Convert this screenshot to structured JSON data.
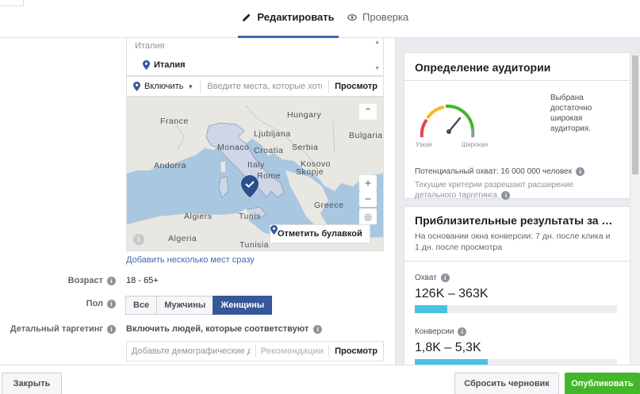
{
  "tabs": {
    "edit": "Редактировать",
    "review": "Проверка"
  },
  "locations": {
    "country_header": "Италия",
    "selected": "Италия",
    "include_label": "Включить",
    "search_placeholder": "Введите места, которые хоти…",
    "browse": "Просмотр",
    "add_multiple": "Добавить несколько мест сразу"
  },
  "map": {
    "labels": {
      "france": "France",
      "ljubljana": "Ljubljana",
      "hungary": "Hungary",
      "monaco": "Monaco",
      "serbia": "Serbia",
      "italy": "Italy",
      "andorra": "Andorra",
      "rome": "Rome",
      "skopje": "Skopje",
      "algiers": "Algiers",
      "tunis": "Tunis",
      "greece": "Greece",
      "algeria": "Algeria",
      "tunisia": "Tunisia",
      "bulgaria": "Bulgaria",
      "croatia": "Croatia",
      "kosovo": "Kosovo"
    },
    "drop_pin": "Отметить булавкой"
  },
  "age": {
    "label": "Возраст",
    "value": "18 - 65+"
  },
  "gender": {
    "label": "Пол",
    "options": [
      "Все",
      "Мужчины",
      "Женщины"
    ],
    "selected": "Женщины"
  },
  "detailed_targeting": {
    "label": "Детальный таргетинг",
    "heading": "Включить людей, которые соответствуют",
    "placeholder": "Добавьте демографические данные",
    "recommendations": "Рекомендации",
    "browse": "Просмотр"
  },
  "audience": {
    "title": "Определение аудитории",
    "narrow": "Узкая",
    "wide": "Широкая",
    "summary": "Выбрана достаточно широкая аудитория.",
    "potential_reach": "Потенциальный охват: 16 000 000 человек",
    "criteria_note": "Текущие критерии разрешают расширение детального таргетинга."
  },
  "results": {
    "title": "Приблизительные результаты за …",
    "description": "На основании окна конверсии: 7 дн. после клика и 1 дн. после просмотра",
    "reach_label": "Охват",
    "reach_value": "126K – 363K",
    "reach_fill": 0.16,
    "conversions_label": "Конверсии",
    "conversions_value": "1,8K – 5,3K",
    "conversions_fill": 0.36
  },
  "footer": {
    "close": "Закрыть",
    "reset": "Сбросить черновик",
    "publish": "Опубликовать"
  },
  "colors": {
    "accent": "#4267b2",
    "selected_gender": "#365899",
    "publish": "#42b72a",
    "bar": "#4bc2e3"
  }
}
